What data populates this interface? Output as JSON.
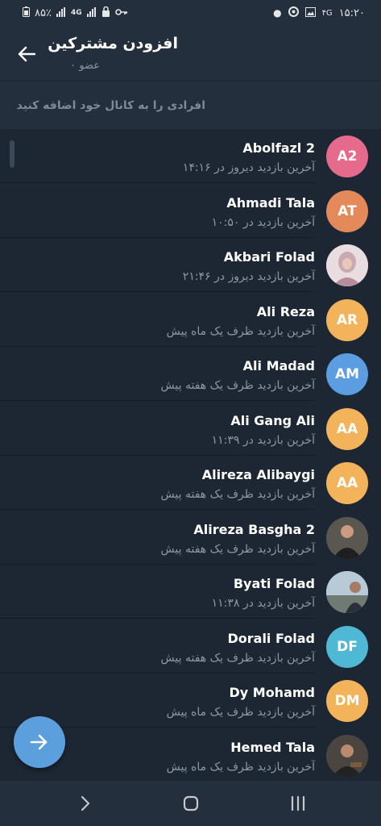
{
  "status_bar": {
    "left_text": "۸۵٪",
    "right_time": "۱۵:۲۰",
    "network": "4G"
  },
  "header": {
    "title": "افزودن مشترکین",
    "subtitle": "۰ عضو"
  },
  "search": {
    "placeholder": "افرادی را به کانال خود اضافه کنید"
  },
  "contacts": [
    {
      "name": "Abolfazl 2",
      "status": "آخرین بازدید دیروز در ۱۴:۱۶",
      "initials": "A2",
      "avatar_color": "#e56a8b",
      "photo": false
    },
    {
      "name": "Ahmadi Tala",
      "status": "آخرین بازدید در ۱۰:۵۰",
      "initials": "AT",
      "avatar_color": "#e48a5a",
      "photo": false
    },
    {
      "name": "Akbari Folad",
      "status": "آخرین بازدید دیروز در ۲۱:۴۶",
      "initials": "",
      "avatar_color": "#d7c6c9",
      "photo": true
    },
    {
      "name": "Ali Reza",
      "status": "آخرین بازدید ظرف یک ماه پیش",
      "initials": "AR",
      "avatar_color": "#f2b35b",
      "photo": false
    },
    {
      "name": "Ali Madad",
      "status": "آخرین بازدید ظرف یک هفته پیش",
      "initials": "AM",
      "avatar_color": "#5c9ce0",
      "photo": false
    },
    {
      "name": "Ali Gang Ali",
      "status": "آخرین بازدید در ۱۱:۳۹",
      "initials": "AA",
      "avatar_color": "#f2b35b",
      "photo": false
    },
    {
      "name": "Alireza Alibaygi",
      "status": "آخرین بازدید ظرف یک هفته پیش",
      "initials": "AA",
      "avatar_color": "#f2b35b",
      "photo": false
    },
    {
      "name": "Alireza Basgha 2",
      "status": "آخرین بازدید ظرف یک هفته پیش",
      "initials": "",
      "avatar_color": "#4a4440",
      "photo": true
    },
    {
      "name": "Byati Folad",
      "status": "آخرین بازدید در ۱۱:۳۸",
      "initials": "",
      "avatar_color": "#8aa4b8",
      "photo": true
    },
    {
      "name": "Dorali Folad",
      "status": "آخرین بازدید ظرف یک هفته پیش",
      "initials": "DF",
      "avatar_color": "#4fb8d4",
      "photo": false
    },
    {
      "name": "Dy Mohamd",
      "status": "آخرین بازدید ظرف یک ماه پیش",
      "initials": "DM",
      "avatar_color": "#f2b35b",
      "photo": false
    },
    {
      "name": "Hemed Tala",
      "status": "آخرین بازدید ظرف یک ماه پیش",
      "initials": "",
      "avatar_color": "#3e3a36",
      "photo": true
    }
  ],
  "icons": {
    "back": "arrow-left-icon",
    "fab": "arrow-right-icon",
    "nav_back": "chevron-right-icon",
    "nav_home": "square-home-icon",
    "nav_recents": "recents-icon"
  },
  "colors": {
    "background": "#1d2733",
    "appbar": "#232f3c",
    "accent": "#5b9fdd",
    "secondary_text": "#8b98a5"
  }
}
